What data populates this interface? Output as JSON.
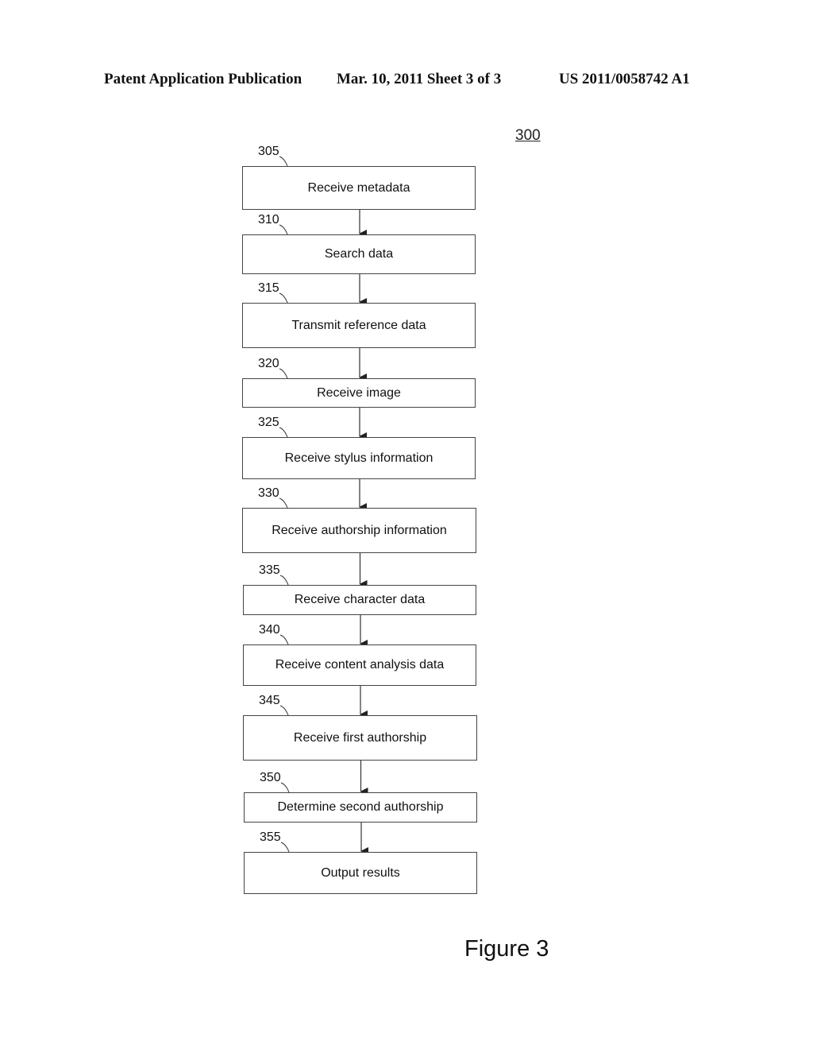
{
  "header": {
    "publication": "Patent Application Publication",
    "date_sheet": "Mar. 10, 2011  Sheet 3 of 3",
    "patent_number": "US 2011/0058742 A1"
  },
  "figure": {
    "reference": "300",
    "caption": "Figure 3"
  },
  "steps": [
    {
      "ref": "305",
      "label": "Receive metadata"
    },
    {
      "ref": "310",
      "label": "Search data"
    },
    {
      "ref": "315",
      "label": "Transmit reference data"
    },
    {
      "ref": "320",
      "label": "Receive image"
    },
    {
      "ref": "325",
      "label": "Receive stylus information"
    },
    {
      "ref": "330",
      "label": "Receive authorship information"
    },
    {
      "ref": "335",
      "label": "Receive character data"
    },
    {
      "ref": "340",
      "label": "Receive content analysis data"
    },
    {
      "ref": "345",
      "label": "Receive first authorship"
    },
    {
      "ref": "350",
      "label": "Determine second authorship"
    },
    {
      "ref": "355",
      "label": "Output results"
    }
  ]
}
